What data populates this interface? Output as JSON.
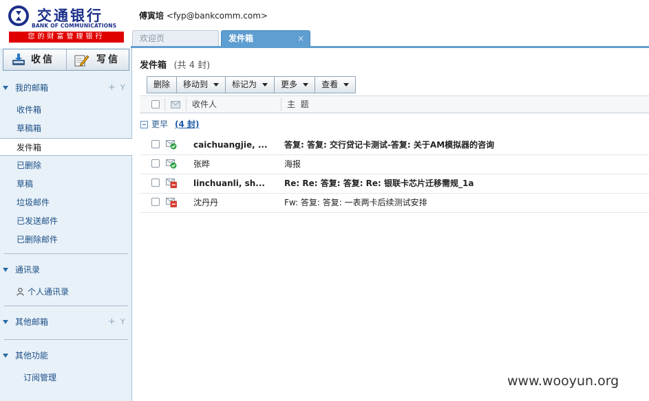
{
  "brand": {
    "name_cn": "交通银行",
    "name_en": "BANK OF COMMUNICATIONS",
    "slogan": "您的财富管理银行",
    "logo_icon": "bank-logo-icon",
    "brand_color": "#1b2f8a",
    "slogan_color": "#e00000"
  },
  "user": {
    "name": "傅寅培",
    "email": "<fyp@bankcomm.com>"
  },
  "tabs": [
    {
      "label": "欢迎页"
    },
    {
      "label": "发件箱",
      "close": "×"
    }
  ],
  "sidebar": {
    "receive_label": "收信",
    "compose_label": "写信",
    "my_mailbox": {
      "title": "我的邮箱",
      "plus": "+",
      "y": "Y",
      "items": [
        {
          "label": "收件箱"
        },
        {
          "label": "草稿箱"
        },
        {
          "label": "发件箱"
        },
        {
          "label": "已删除"
        },
        {
          "label": "草稿"
        },
        {
          "label": "垃圾邮件"
        },
        {
          "label": "已发送邮件"
        },
        {
          "label": "已删除邮件"
        }
      ]
    },
    "contacts": {
      "title": "通讯录",
      "items": [
        {
          "label": "个人通讯录"
        }
      ]
    },
    "other_mailboxes": {
      "title": "其他邮箱",
      "plus": "+",
      "y": "Y"
    },
    "other_functions": {
      "title": "其他功能",
      "items": [
        {
          "label": "订阅管理"
        }
      ]
    }
  },
  "main": {
    "folder_title": "发件箱",
    "folder_count": "(共 4 封)",
    "toolbar": {
      "delete": "删除",
      "move_to": "移动到",
      "mark_as": "标记为",
      "more": "更多",
      "view": "查看"
    },
    "columns": {
      "recipient": "收件人",
      "subject": "主  题"
    },
    "group": {
      "label": "更早",
      "count": "(4 封)"
    },
    "messages": [
      {
        "recipient": "caichuangjie, ...",
        "subject": "答复: 答复: 交行贷记卡测试-答复: 关于AM模拟器的咨询",
        "status_icon": "sent-ok-icon",
        "bold": true
      },
      {
        "recipient": "张晔",
        "subject": "海报",
        "status_icon": "sent-ok-icon",
        "bold": false
      },
      {
        "recipient": "linchuanli, sh...",
        "subject": "Re: Re: 答复: 答复: Re: 银联卡芯片迁移需规_1a",
        "status_icon": "send-failed-icon",
        "bold": true
      },
      {
        "recipient": "沈丹丹",
        "subject": "Fw: 答复: 答复: 一表两卡后续测试安排",
        "status_icon": "send-failed-icon",
        "bold": false
      }
    ]
  },
  "watermark": "www.wooyun.org"
}
